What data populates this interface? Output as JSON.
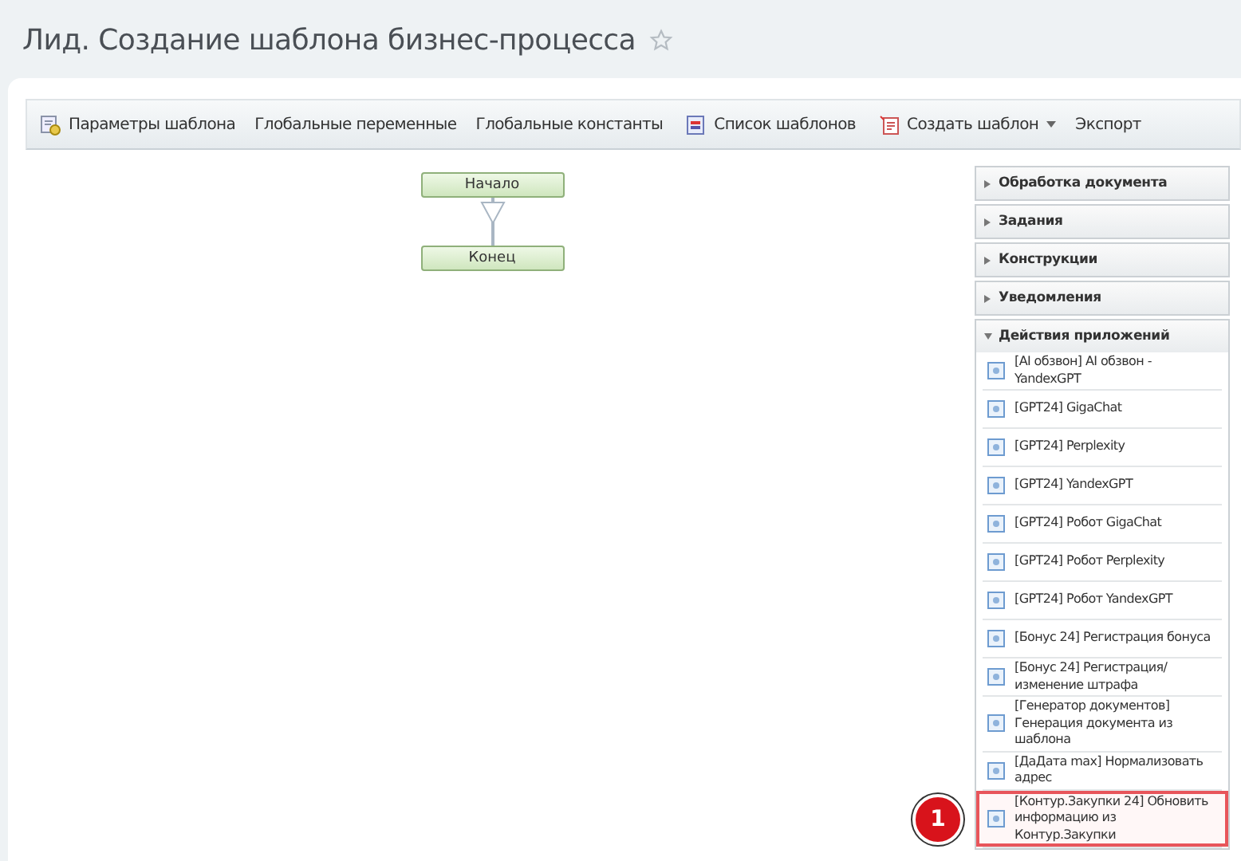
{
  "title": "Лид. Создание шаблона бизнес-процесса",
  "toolbar": [
    {
      "label": "Параметры шаблона",
      "kind": "params",
      "dropdown": false
    },
    {
      "label": "Глобальные переменные",
      "kind": "plain",
      "dropdown": false
    },
    {
      "label": "Глобальные константы",
      "kind": "plain",
      "dropdown": false
    },
    {
      "label": "Список шаблонов",
      "kind": "list",
      "dropdown": false
    },
    {
      "label": "Создать шаблон",
      "kind": "create",
      "dropdown": true
    },
    {
      "label": "Экспорт",
      "kind": "plain",
      "dropdown": false
    }
  ],
  "diagram": {
    "start": "Начало",
    "end": "Конец"
  },
  "sections": [
    {
      "title": "Обработка документа",
      "expanded": false
    },
    {
      "title": "Задания",
      "expanded": false
    },
    {
      "title": "Конструкции",
      "expanded": false
    },
    {
      "title": "Уведомления",
      "expanded": false
    },
    {
      "title": "Действия приложений",
      "expanded": true,
      "items": [
        {
          "label": "[AI обзвон] AI обзвон - YandexGPT",
          "highlighted": false
        },
        {
          "label": "[GPT24] GigaChat",
          "highlighted": false
        },
        {
          "label": "[GPT24] Perplexity",
          "highlighted": false
        },
        {
          "label": "[GPT24] YandexGPT",
          "highlighted": false
        },
        {
          "label": "[GPT24] Робот GigaChat",
          "highlighted": false
        },
        {
          "label": "[GPT24] Робот Perplexity",
          "highlighted": false
        },
        {
          "label": "[GPT24] Робот YandexGPT",
          "highlighted": false
        },
        {
          "label": "[Бонус 24] Регистрация бонуса",
          "highlighted": false
        },
        {
          "label": "[Бонус 24] Регистрация/ изменение штрафа",
          "highlighted": false
        },
        {
          "label": "[Генератор документов] Генерация документа из шаблона",
          "highlighted": false
        },
        {
          "label": "[ДаДата max] Нормализовать адрес",
          "highlighted": false
        },
        {
          "label": "[Контур.Закупки 24] Обновить информацию из Контур.Закупки",
          "highlighted": true,
          "badge": "1"
        }
      ]
    }
  ]
}
